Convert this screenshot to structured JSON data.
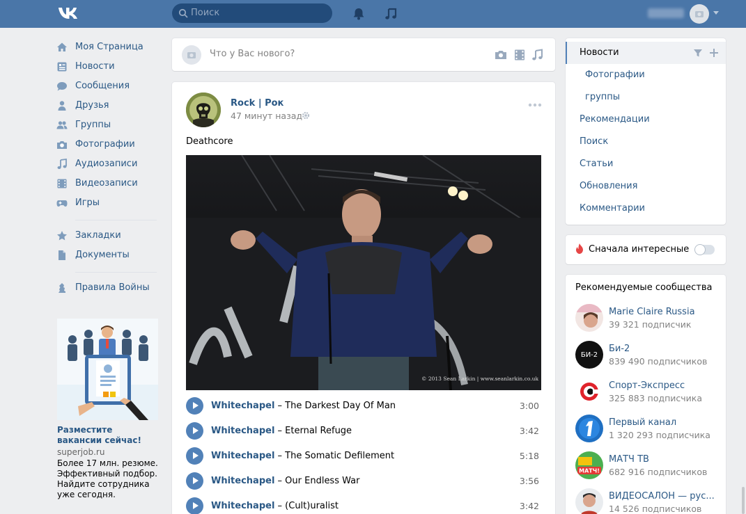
{
  "header": {
    "logo": "VK",
    "search_placeholder": "Поиск"
  },
  "nav": {
    "items": [
      {
        "label": "Моя Страница",
        "icon": "home-icon"
      },
      {
        "label": "Новости",
        "icon": "news-icon"
      },
      {
        "label": "Сообщения",
        "icon": "messages-icon"
      },
      {
        "label": "Друзья",
        "icon": "friends-icon"
      },
      {
        "label": "Группы",
        "icon": "groups-icon"
      },
      {
        "label": "Фотографии",
        "icon": "camera-icon"
      },
      {
        "label": "Аудиозаписи",
        "icon": "music-note-icon"
      },
      {
        "label": "Видеозаписи",
        "icon": "film-icon"
      },
      {
        "label": "Игры",
        "icon": "gamepad-icon"
      },
      {
        "label": "Закладки",
        "icon": "star-icon"
      },
      {
        "label": "Документы",
        "icon": "document-icon"
      },
      {
        "label": "Правила Войны",
        "icon": "app-icon"
      }
    ]
  },
  "ad": {
    "title": "Разместите вакансии сейчас!",
    "domain": "superjob.ru",
    "text": "Более 17 млн. резюме. Эффективный подбор. Найдите сотрудника уже сегодня."
  },
  "composer": {
    "placeholder": "Что у Вас нового?"
  },
  "post": {
    "author": "Rock | Рок",
    "time": "47 минут назад",
    "text": "Deathcore",
    "photo_credit": "© 2013 Sean Larkin | www.seanlarkin.co.uk",
    "tracks": [
      {
        "artist": "Whitechapel",
        "title": "The Darkest Day Of Man",
        "duration": "3:00"
      },
      {
        "artist": "Whitechapel",
        "title": "Eternal Refuge",
        "duration": "3:42"
      },
      {
        "artist": "Whitechapel",
        "title": "The Somatic Defilement",
        "duration": "5:18"
      },
      {
        "artist": "Whitechapel",
        "title": "Our Endless War",
        "duration": "3:56"
      },
      {
        "artist": "Whitechapel",
        "title": "(Cult)uralist",
        "duration": "3:42"
      }
    ]
  },
  "filters": {
    "items": [
      {
        "label": "Новости"
      },
      {
        "label": "Фотографии"
      },
      {
        "label": "группы"
      },
      {
        "label": "Рекомендации"
      },
      {
        "label": "Поиск"
      },
      {
        "label": "Статьи"
      },
      {
        "label": "Обновления"
      },
      {
        "label": "Комментарии"
      }
    ]
  },
  "interesting": {
    "label": "Сначала интересные",
    "enabled": false
  },
  "recs": {
    "title": "Рекомендуемые сообщества",
    "items": [
      {
        "name": "Marie Claire Russia",
        "subs": "39 321 подписчик"
      },
      {
        "name": "Би-2",
        "subs": "839 490 подписчиков",
        "logo_text": "БИ-2"
      },
      {
        "name": "Спорт-Экспресс",
        "subs": "325 883 подписчика"
      },
      {
        "name": "Первый канал",
        "subs": "1 320 293 подписчика"
      },
      {
        "name": "МАТЧ ТВ",
        "subs": "682 916 подписчиков",
        "logo_text": "МАТЧ!"
      },
      {
        "name": "ВИДЕОСАЛОН — рус...",
        "subs": "14 526 подписчиков"
      }
    ]
  },
  "colors": {
    "header": "#4a76a8",
    "link": "#2a5885",
    "accent": "#5181b8",
    "page_bg": "#edeef0"
  }
}
